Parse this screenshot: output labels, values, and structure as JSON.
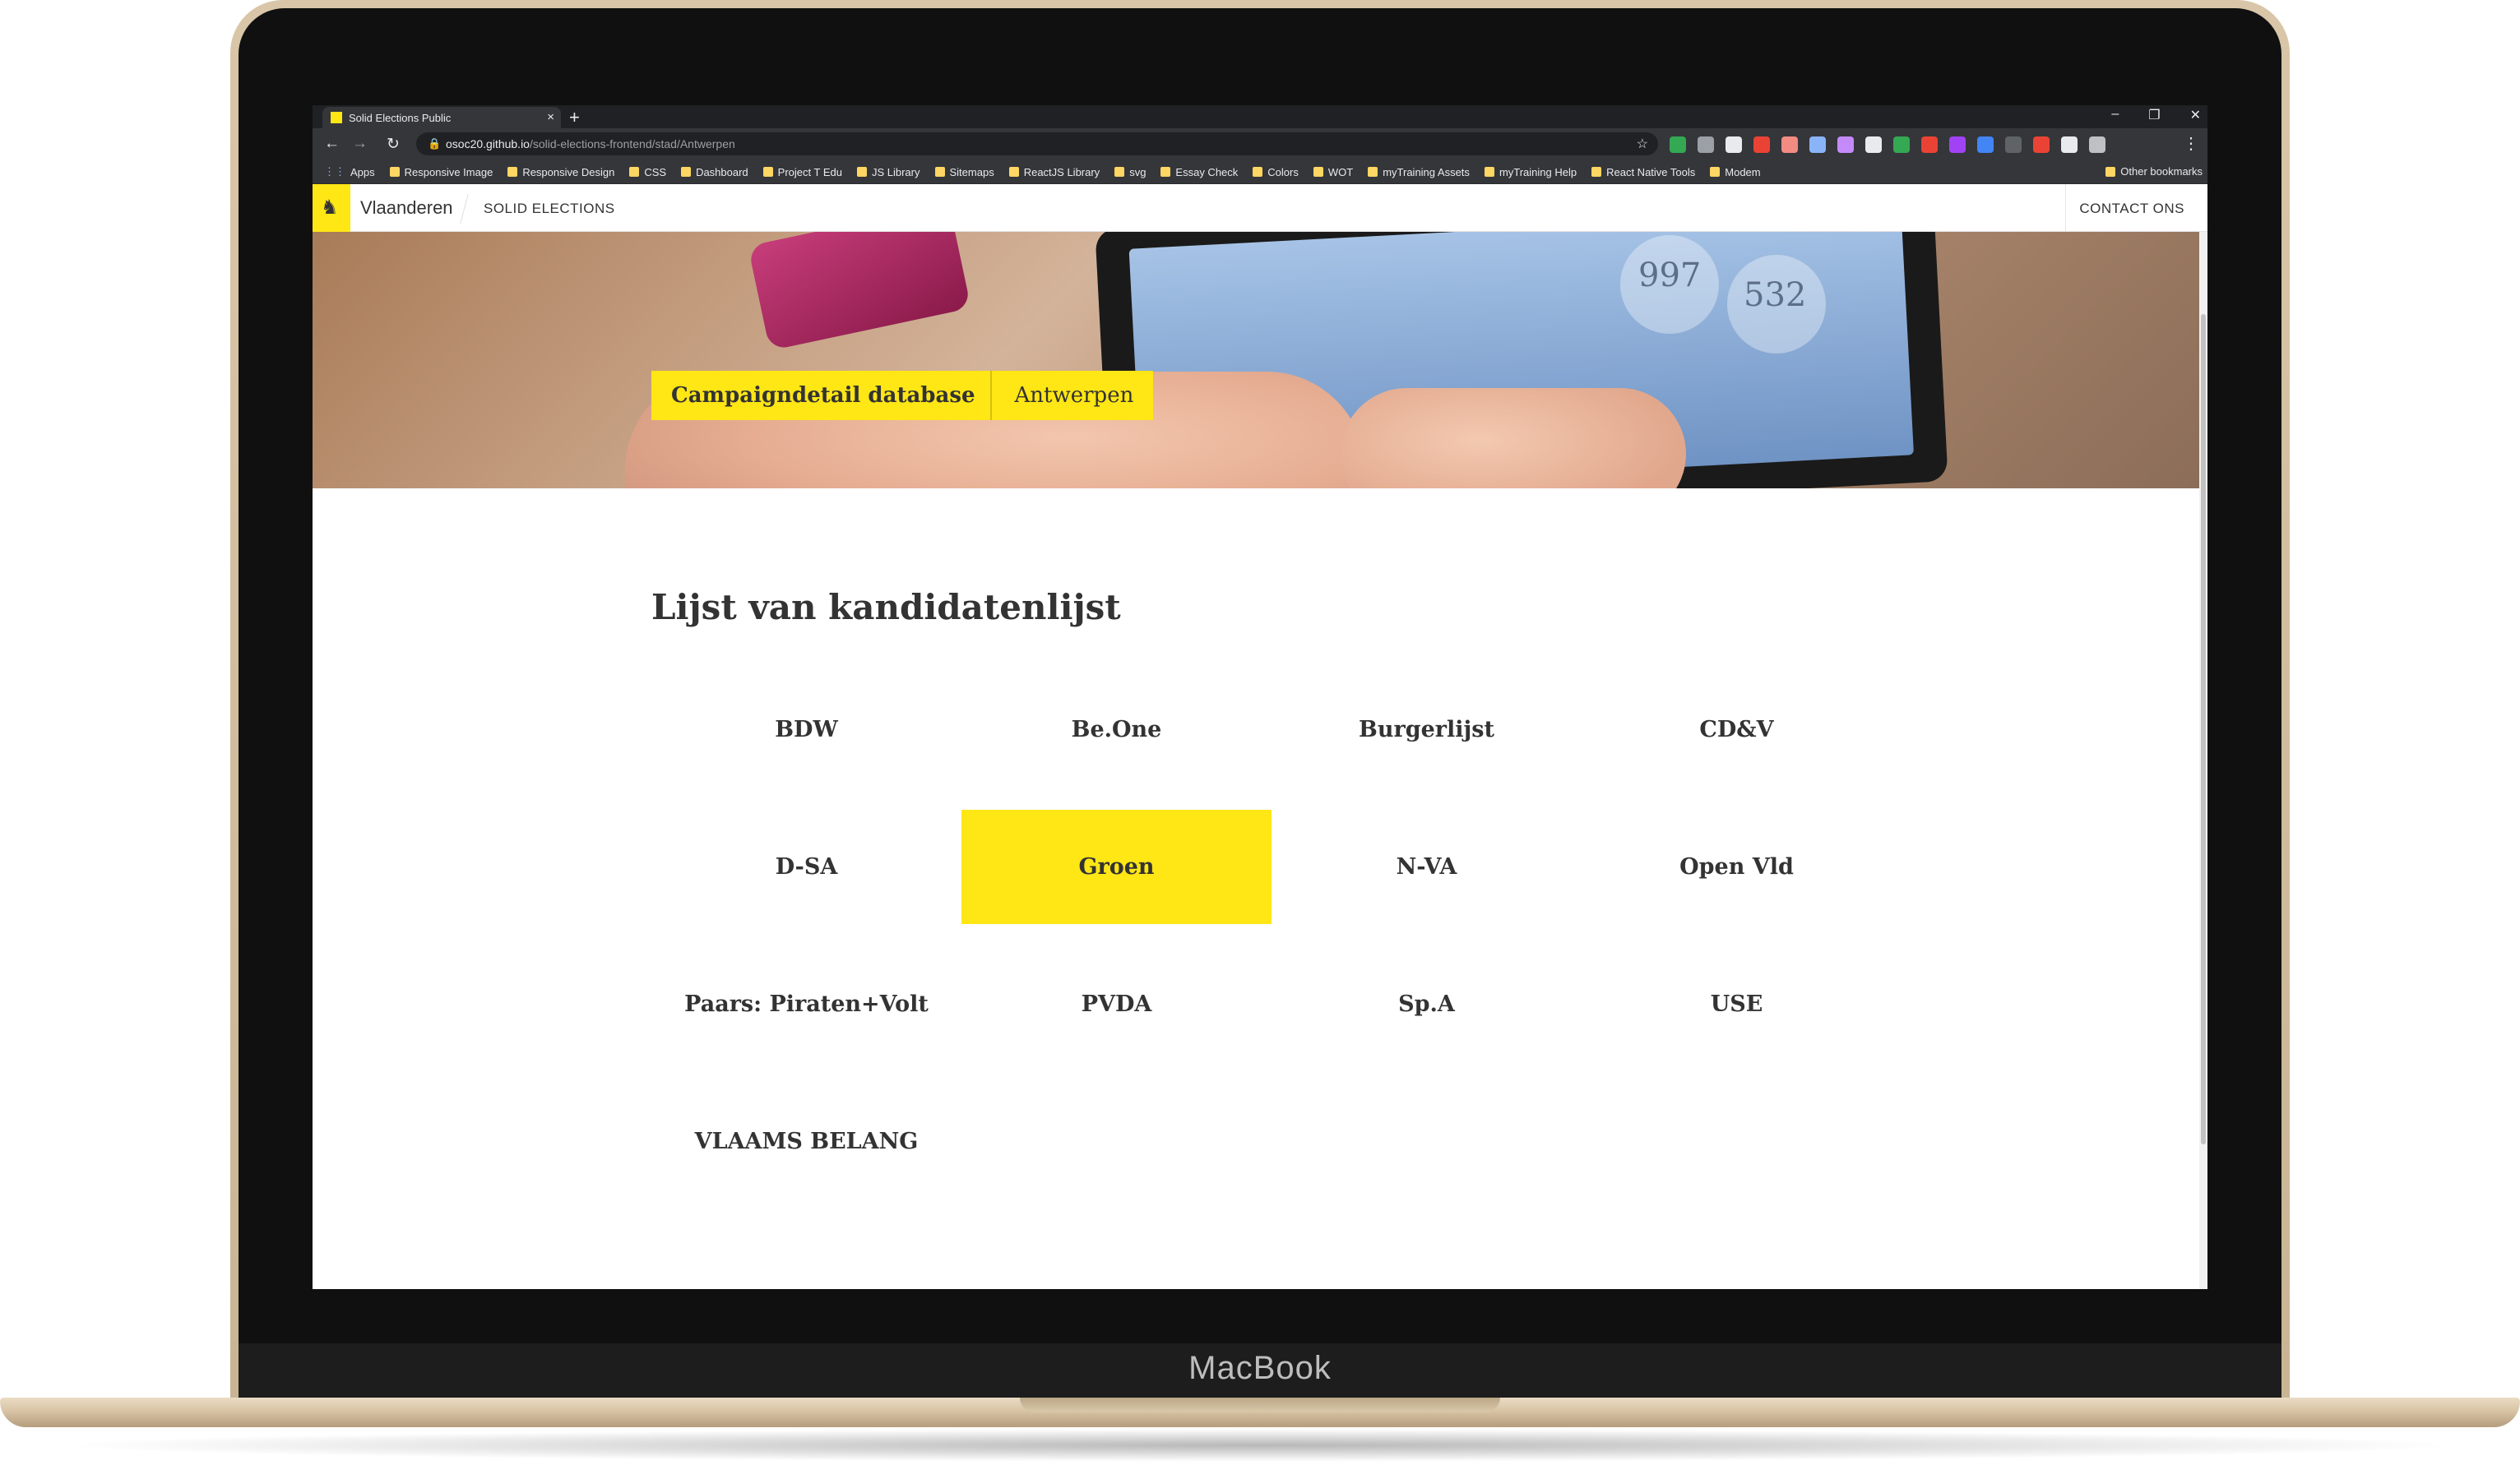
{
  "device": {
    "brand": "MacBook"
  },
  "browser": {
    "tab_title": "Solid Elections Public",
    "tab_close": "×",
    "new_tab": "+",
    "window_controls": [
      "–",
      "❐",
      "✕"
    ],
    "nav": {
      "back": "←",
      "forward": "→",
      "reload": "↻"
    },
    "url_host": "osoc20.github.io",
    "url_path": "/solid-elections-frontend/stad/Antwerpen",
    "bookmarks": [
      "Apps",
      "Responsive Image",
      "Responsive Design",
      "CSS",
      "Dashboard",
      "Project T Edu",
      "JS Library",
      "Sitemaps",
      "ReactJS Library",
      "svg",
      "Essay Check",
      "Colors",
      "WOT",
      "myTraining Assets",
      "myTraining Help",
      "React Native Tools",
      "Modem"
    ],
    "other_bookmarks": "Other bookmarks",
    "extension_colors": [
      "#34a853",
      "#9aa0a6",
      "#e8eaed",
      "#ea4335",
      "#f28b82",
      "#8ab4f8",
      "#c58af9",
      "#e8eaed",
      "#34a853",
      "#ea4335",
      "#a142f4",
      "#4285f4",
      "#5f6368",
      "#ea4335",
      "#e8eaed",
      "#bdc1c6"
    ]
  },
  "header": {
    "site_name": "Vlaanderen",
    "app_name": "SOLID ELECTIONS",
    "contact": "CONTACT ONS"
  },
  "hero": {
    "badge_main": "Campaigndetail database",
    "badge_sub": "Antwerpen",
    "tablet_numbers": [
      "997",
      "532"
    ]
  },
  "main": {
    "title": "Lijst van kandidatenlijst",
    "parties": [
      "BDW",
      "Be.One",
      "Burgerlijst",
      "CD&V",
      "D-SA",
      "Groen",
      "N-VA",
      "Open Vld",
      "Paars: Piraten+Volt",
      "PVDA",
      "Sp.A",
      "USE",
      "VLAAMS BELANG"
    ],
    "active_party": "Groen"
  },
  "colors": {
    "accent": "#ffe615",
    "text": "#333333",
    "browser_dark": "#202124",
    "browser_toolbar": "#35363a"
  }
}
